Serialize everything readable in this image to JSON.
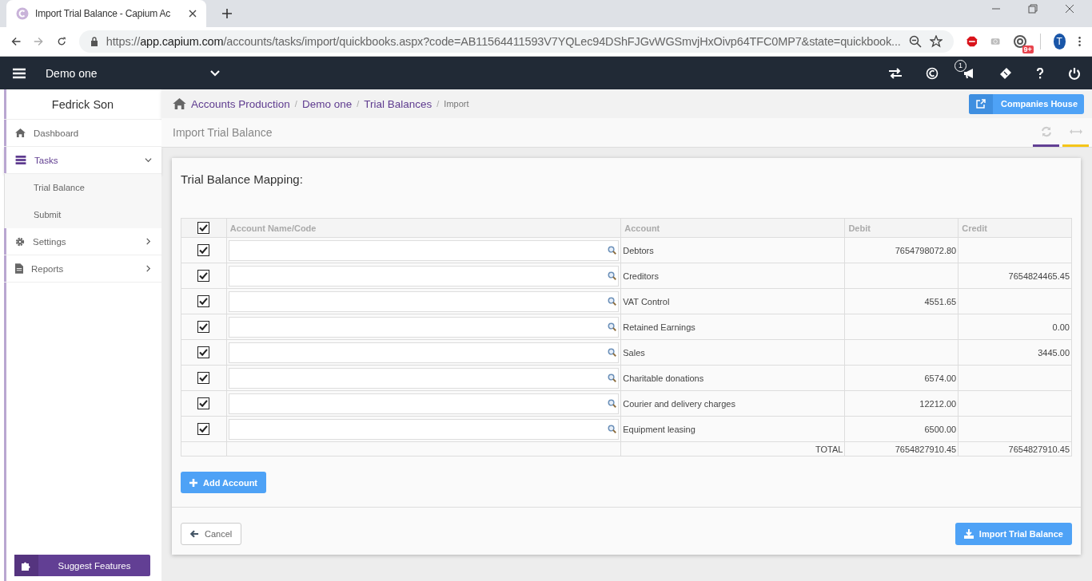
{
  "browser": {
    "tab_title": "Import Trial Balance - Capium Ac",
    "url_scheme": "https://",
    "url_host": "app.capium.com",
    "url_path": "/accounts/tasks/import/quickbooks.aspx?code=AB11564411593V7YQLec94DShFJGvWGSmvjHxOivp64TFC0MP7&state=quickbook...",
    "extension_badge": "9+",
    "profile_initial": "T"
  },
  "app_bar": {
    "company": "Demo one",
    "notification_count": "1"
  },
  "sidebar": {
    "user": "Fedrick Son",
    "items": [
      {
        "label": "Dashboard",
        "selected": false
      },
      {
        "label": "Tasks",
        "selected": true,
        "expanded": true,
        "children": [
          {
            "label": "Trial Balance"
          },
          {
            "label": "Submit"
          }
        ]
      },
      {
        "label": "Settings",
        "selected": false,
        "expanded": false
      },
      {
        "label": "Reports",
        "selected": false,
        "expanded": false
      }
    ],
    "suggest_button": "Suggest Features"
  },
  "breadcrumb": [
    "Accounts Production",
    "Demo one",
    "Trial Balances",
    "Import"
  ],
  "breadcrumb_separator": "/",
  "companies_house_button": "Companies House",
  "page_title": "Import Trial Balance",
  "card": {
    "title": "Trial Balance Mapping:",
    "header_checked": true,
    "columns": [
      "Account Name/Code",
      "Account",
      "Debit",
      "Credit"
    ],
    "rows": [
      {
        "checked": true,
        "account": "Debtors",
        "debit": "7654798072.80"
      },
      {
        "checked": true,
        "account": "Creditors",
        "credit": "7654824465.45"
      },
      {
        "checked": true,
        "account": "VAT Control",
        "debit": "4551.65"
      },
      {
        "checked": true,
        "account": "Retained Earnings",
        "credit": "0.00"
      },
      {
        "checked": true,
        "account": "Sales",
        "credit": "3445.00"
      },
      {
        "checked": true,
        "account": "Charitable donations",
        "debit": "6574.00"
      },
      {
        "checked": true,
        "account": "Courier and delivery charges",
        "debit": "12212.00"
      },
      {
        "checked": true,
        "account": "Equipment leasing",
        "debit": "6500.00"
      }
    ],
    "total_label": "TOTAL",
    "total_debit": "7654827910.45",
    "total_credit": "7654827910.45",
    "add_button": "Add Account",
    "cancel_button": "Cancel",
    "import_button": "Import Trial Balance"
  }
}
